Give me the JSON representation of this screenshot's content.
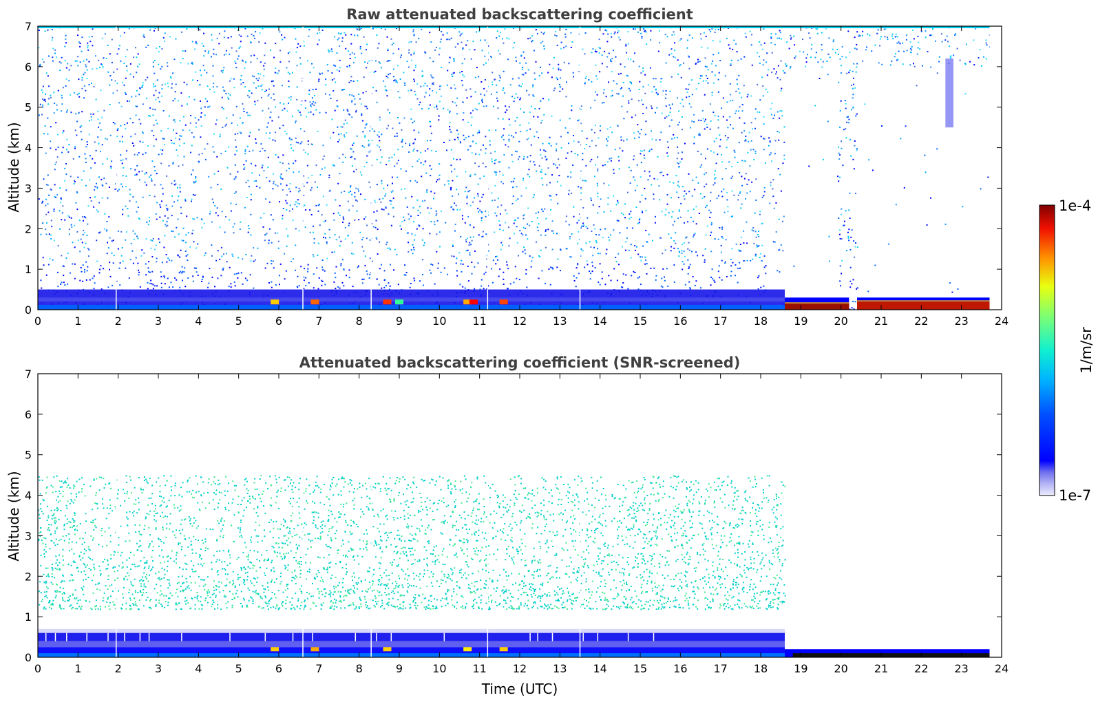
{
  "chart_data": [
    {
      "type": "heatmap",
      "title": "Raw attenuated backscattering coefficient",
      "xlabel": "",
      "ylabel": "Altitude (km)",
      "xlim": [
        0,
        24
      ],
      "ylim": [
        0,
        7
      ],
      "x_ticks": [
        "0",
        "1",
        "2",
        "3",
        "4",
        "5",
        "6",
        "7",
        "8",
        "9",
        "10",
        "11",
        "12",
        "13",
        "14",
        "15",
        "16",
        "17",
        "18",
        "19",
        "20",
        "21",
        "22",
        "23",
        "24"
      ],
      "y_ticks": [
        "0",
        "1",
        "2",
        "3",
        "4",
        "5",
        "6",
        "7"
      ],
      "data_end_time": 23.7,
      "features": [
        {
          "kind": "surface_layer",
          "x": [
            0,
            23.7
          ],
          "y_top": 0.5
        },
        {
          "kind": "noise_free_gap",
          "x": [
            18.6,
            19.9
          ],
          "y_top": 6.0
        },
        {
          "kind": "noise_free_gap",
          "x": [
            20.4,
            23.7
          ],
          "y_top": 6.0
        },
        {
          "kind": "dense_aerosol",
          "x": [
            18.6,
            20.2
          ],
          "y": [
            0.0,
            0.15
          ]
        },
        {
          "kind": "dense_aerosol",
          "x": [
            20.4,
            23.7
          ],
          "y": [
            0.0,
            0.2
          ]
        },
        {
          "kind": "elevated_signal",
          "x": [
            22.6,
            22.8
          ],
          "y": [
            4.5,
            6.2
          ]
        }
      ],
      "data_gaps": [
        1.95,
        6.6,
        8.3,
        11.2,
        13.5
      ]
    },
    {
      "type": "heatmap",
      "title": "Attenuated backscattering coefficient (SNR-screened)",
      "xlabel": "Time (UTC)",
      "ylabel": "Altitude (km)",
      "xlim": [
        0,
        24
      ],
      "ylim": [
        0,
        7
      ],
      "x_ticks": [
        "0",
        "1",
        "2",
        "3",
        "4",
        "5",
        "6",
        "7",
        "8",
        "9",
        "10",
        "11",
        "12",
        "13",
        "14",
        "15",
        "16",
        "17",
        "18",
        "19",
        "20",
        "21",
        "22",
        "23",
        "24"
      ],
      "y_ticks": [
        "0",
        "1",
        "2",
        "3",
        "4",
        "5",
        "6",
        "7"
      ],
      "data_end_time": 23.7,
      "features": [
        {
          "kind": "boundary_layer",
          "x": [
            0,
            18.6
          ],
          "y_top": 0.7
        },
        {
          "kind": "boundary_layer",
          "x": [
            18.6,
            23.7
          ],
          "y_top": 0.2
        },
        {
          "kind": "sparse_aerosol",
          "x": [
            0,
            18.6
          ],
          "y": [
            1.2,
            4.5
          ]
        },
        {
          "kind": "dense_aerosol",
          "x": [
            18.8,
            23.7
          ],
          "y": [
            0.0,
            0.1
          ]
        }
      ],
      "data_gaps": [
        1.95,
        6.6,
        8.3,
        11.2,
        13.5
      ]
    }
  ],
  "colorbar": {
    "label": "1/m/sr",
    "max_label": "1e-4",
    "min_label": "1e-7",
    "scale": "log",
    "colormap": "jet",
    "low_end_colors": [
      "#e6e6fa",
      "#b4b4f5",
      "#7878f0"
    ]
  }
}
